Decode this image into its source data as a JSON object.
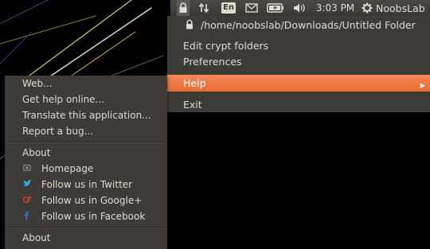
{
  "panel": {
    "clock": "3:03 PM",
    "language": "En",
    "username": "NoobsLab"
  },
  "indicator_menu": {
    "folder_path": "/home/noobslab/Downloads/Untitled Folder",
    "items": [
      {
        "label": "Edit crypt folders"
      },
      {
        "label": "Preferences"
      },
      {
        "label": "Help"
      },
      {
        "label": "Exit"
      }
    ],
    "submenu_arrow": "▸"
  },
  "help_submenu": {
    "items": [
      {
        "label": "Web..."
      },
      {
        "label": "Get help online..."
      },
      {
        "label": "Translate this application..."
      },
      {
        "label": "Report a bug..."
      },
      {
        "label": "About"
      },
      {
        "label": "Homepage",
        "icon": "homepage-icon"
      },
      {
        "label": "Follow us in Twitter",
        "icon": "twitter-icon"
      },
      {
        "label": "Follow us in Google+",
        "icon": "google-plus-icon"
      },
      {
        "label": "Follow us in Facebook",
        "icon": "facebook-icon"
      },
      {
        "label": "About"
      }
    ]
  },
  "colors": {
    "menu_bg": "#3c3b37",
    "highlight": "#f07746",
    "text": "#dfdbd2"
  }
}
